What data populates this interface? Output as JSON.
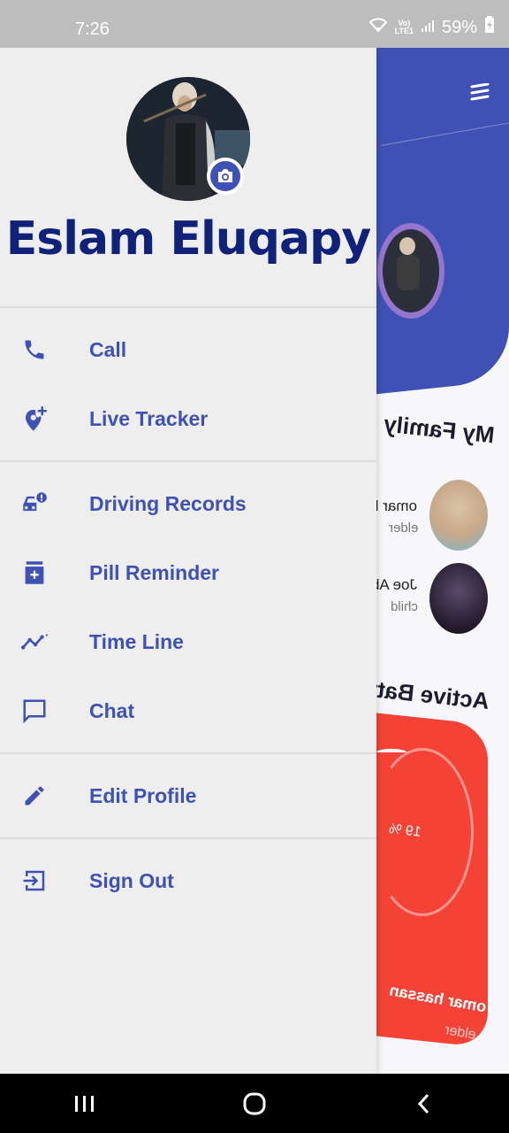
{
  "status_bar": {
    "time": "7:26",
    "network_top": "Vo)",
    "network_bottom": "LTE1",
    "battery": "59%"
  },
  "drawer": {
    "user_name": "Eslam Eluqapy",
    "menu_groups": [
      [
        {
          "label": "Call",
          "icon": "phone-icon"
        },
        {
          "label": "Live Tracker",
          "icon": "add-location-icon"
        }
      ],
      [
        {
          "label": "Driving Records",
          "icon": "car-alert-icon"
        },
        {
          "label": "Pill Reminder",
          "icon": "medication-icon"
        },
        {
          "label": "Time Line",
          "icon": "timeline-icon"
        },
        {
          "label": "Chat",
          "icon": "chat-icon"
        }
      ],
      [
        {
          "label": "Edit Profile",
          "icon": "edit-icon"
        }
      ],
      [
        {
          "label": "Sign Out",
          "icon": "sign-out-icon"
        }
      ]
    ]
  },
  "background_screen": {
    "section_family": "My Family",
    "members": [
      {
        "name": "omar h",
        "role": "elder"
      },
      {
        "name": "Joe Ab",
        "role": "child"
      }
    ],
    "section_battery": "Active Batt",
    "battery_card": {
      "percent": "19 %",
      "name": "omar hassan",
      "role": "elder"
    }
  },
  "colors": {
    "accent": "#3f51b5",
    "name_color": "#10217a",
    "battery_card": "#f44336"
  }
}
